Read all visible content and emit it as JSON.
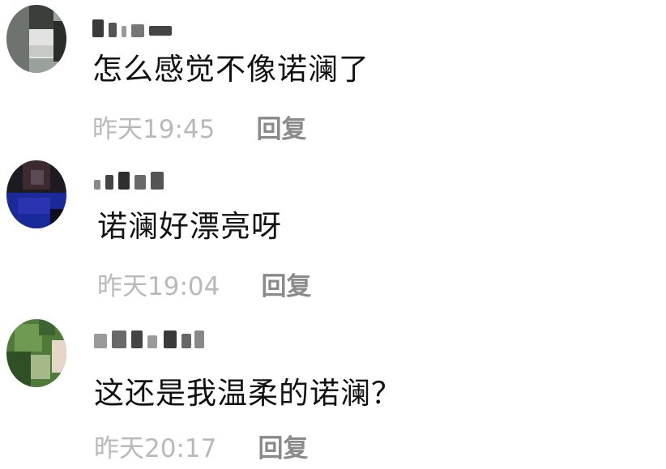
{
  "comments": [
    {
      "content": "怎么感觉不像诺澜了",
      "time": "昨天19:45",
      "reply_label": "回复",
      "avatar_colors": [
        "#9aa09a",
        "#3a3f3a",
        "#e2e2e2",
        "#6f736f",
        "#c7c9c7",
        "#2a2d2a"
      ]
    },
    {
      "content": "诺澜好漂亮呀",
      "time": "昨天19:04",
      "reply_label": "回复",
      "avatar_colors": [
        "#1e1a22",
        "#3d2a2e",
        "#1a2a9a",
        "#2b33b0",
        "#0e0f1a",
        "#5a4a55"
      ]
    },
    {
      "content": "这还是我温柔的诺澜？",
      "time": "昨天20:17",
      "reply_label": "回复",
      "avatar_colors": [
        "#4f7a3a",
        "#6f9a52",
        "#2f4f25",
        "#a4b88a",
        "#e6d6c8",
        "#3d6330"
      ]
    }
  ]
}
